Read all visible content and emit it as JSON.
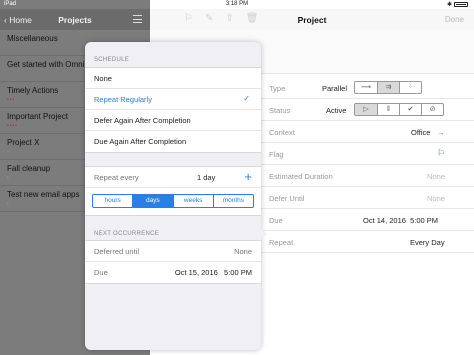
{
  "status_bar": {
    "carrier": "iPad",
    "time": "3:18 PM"
  },
  "sidebar": {
    "back_label": "Home",
    "title": "Projects",
    "items": [
      {
        "label": "Miscellaneous",
        "dots": ""
      },
      {
        "label": "Get started with Omni",
        "dots": ""
      },
      {
        "label": "Timely Actions",
        "dots": "•••",
        "dot_color": "#c2185b"
      },
      {
        "label": "Important Project",
        "dots": "••••",
        "dot_color": "#c2185b"
      },
      {
        "label": "Project X",
        "dots": "•",
        "dot_color": "#e08a00"
      },
      {
        "label": "Fall cleanup",
        "dots": "•",
        "dot_color": "#e08a00"
      },
      {
        "label": "Test new email apps",
        "dots": "•",
        "dot_color": "#e08a00"
      }
    ]
  },
  "detail": {
    "title": "Project",
    "done_label": "Done",
    "fields": {
      "type": {
        "label": "Type",
        "value": "Parallel"
      },
      "status": {
        "label": "Status",
        "value": "Active"
      },
      "context": {
        "label": "Context",
        "value": "Office"
      },
      "flag": {
        "label": "Flag"
      },
      "estimated_duration": {
        "label": "Estimated Duration",
        "value": "None"
      },
      "defer_until": {
        "label": "Defer Until",
        "value": "None"
      },
      "due": {
        "label": "Due",
        "value": "Oct 14, 2016  5:00 PM"
      },
      "repeat": {
        "label": "Repeat",
        "value": "Every Day"
      }
    }
  },
  "popover": {
    "schedule_header": "SCHEDULE",
    "schedule_options": [
      {
        "label": "None",
        "selected": false
      },
      {
        "label": "Repeat Regularly",
        "selected": true
      },
      {
        "label": "Defer Again After Completion",
        "selected": false
      },
      {
        "label": "Due Again After Completion",
        "selected": false
      }
    ],
    "repeat_every_label": "Repeat every",
    "repeat_every_value": "1 day",
    "units": [
      "hours",
      "days",
      "weeks",
      "months"
    ],
    "selected_unit": "days",
    "next_header": "NEXT OCCURRENCE",
    "deferred_label": "Deferred until",
    "deferred_value": "None",
    "due_label": "Due",
    "due_value": "Oct 15, 2016   5:00 PM"
  },
  "colors": {
    "accent": "#2a7fe6",
    "dim_sidebar": "#7c7c7c"
  }
}
